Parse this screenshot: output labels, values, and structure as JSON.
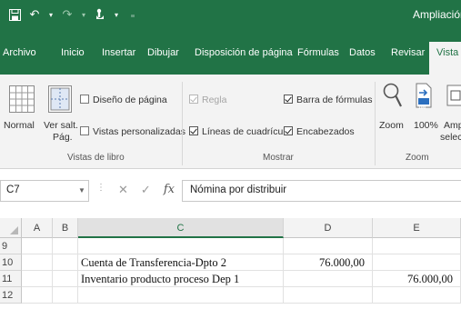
{
  "app": {
    "title": "Ampliación"
  },
  "quick_access": {
    "icons": [
      "save-icon",
      "undo-icon",
      "redo-icon",
      "touch-mode-icon",
      "customize-icon"
    ]
  },
  "tabs": [
    {
      "label": "Archivo"
    },
    {
      "label": "Inicio"
    },
    {
      "label": "Insertar"
    },
    {
      "label": "Dibujar"
    },
    {
      "label": "Disposición de página"
    },
    {
      "label": "Fórmulas"
    },
    {
      "label": "Datos"
    },
    {
      "label": "Revisar"
    },
    {
      "label": "Vista",
      "active": true
    }
  ],
  "ribbon": {
    "workbook_views": {
      "label": "Vistas de libro",
      "normal": "Normal",
      "page_break_line1": "Ver salt.",
      "page_break_line2": "Pág.",
      "page_layout": "Diseño de página",
      "custom_views": "Vistas personalizadas"
    },
    "show": {
      "label": "Mostrar",
      "ruler": "Regla",
      "formula_bar": "Barra de fórmulas",
      "gridlines": "Líneas de cuadrícula",
      "headings": "Encabezados"
    },
    "zoom": {
      "label": "Zoom",
      "zoom": "Zoom",
      "zoom_100": "100%",
      "zoom_selection_line1": "Amp",
      "zoom_selection_line2": "selec",
      "badge_100": "100"
    }
  },
  "formula_bar": {
    "name_box": "C7",
    "formula": "Nómina por distribuir",
    "fx": "fx"
  },
  "sheet": {
    "columns": [
      "A",
      "B",
      "C",
      "D",
      "E"
    ],
    "selected_column": "C",
    "rows": [
      {
        "num": "9",
        "C": "",
        "D": "",
        "E": ""
      },
      {
        "num": "10",
        "C": "Cuenta de Transferencia-Dpto 2",
        "D": "76.000,00",
        "E": ""
      },
      {
        "num": "11",
        "C": "Inventario producto proceso Dep 1",
        "D": "",
        "E": "76.000,00"
      },
      {
        "num": "12",
        "C": "",
        "D": "",
        "E": ""
      }
    ]
  },
  "colors": {
    "brand": "#217346",
    "ribbon_bg": "#f3f3f3"
  }
}
